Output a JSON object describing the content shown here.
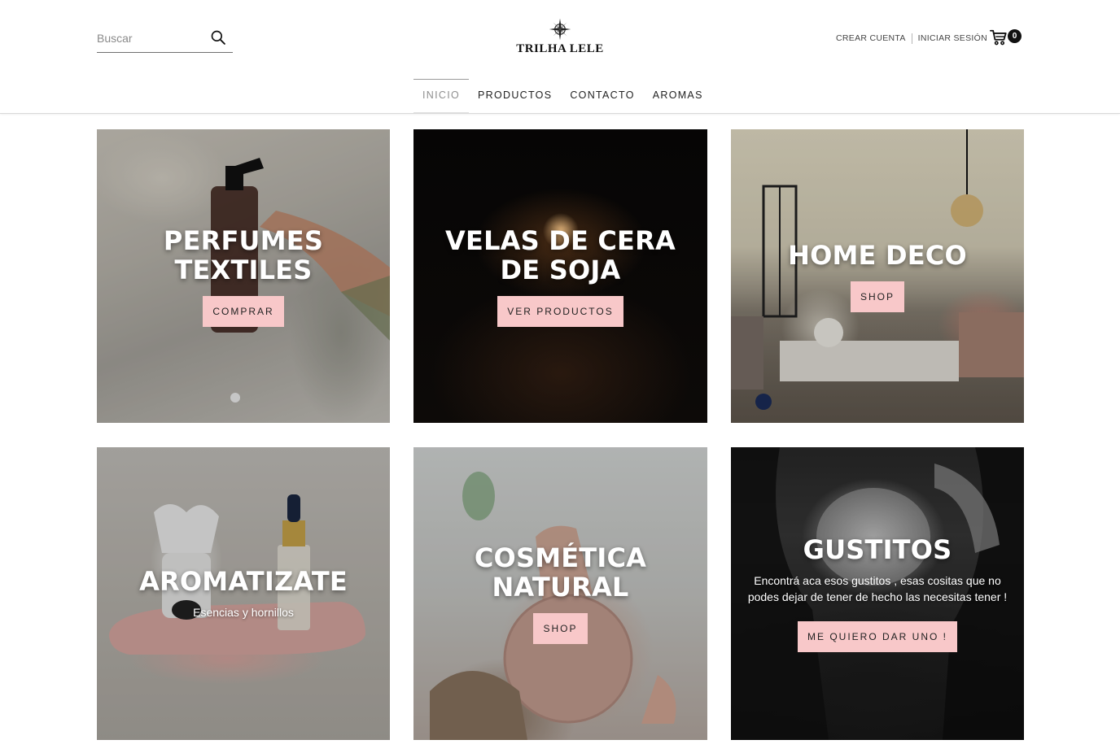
{
  "header": {
    "search_placeholder": "Buscar",
    "brand": "TRILHA LELE",
    "create_account": "CREAR CUENTA",
    "login": "INICIAR SESIÓN",
    "cart_count": "0"
  },
  "nav": {
    "items": [
      {
        "label": "INICIO",
        "active": true
      },
      {
        "label": "PRODUCTOS",
        "active": false
      },
      {
        "label": "CONTACTO",
        "active": false
      },
      {
        "label": "AROMAS",
        "active": false
      }
    ]
  },
  "tiles": [
    {
      "title": "PERFUMES\nTEXTILES",
      "button": "COMPRAR"
    },
    {
      "title": "VELAS DE CERA\nDE SOJA",
      "button": "VER PRODUCTOS"
    },
    {
      "title": "HOME DECO",
      "button": "SHOP"
    },
    {
      "title": "AROMATIZATE",
      "subtitle": "Esencias y hornillos"
    },
    {
      "title": "COSMÉTICA\nNATURAL",
      "button": "SHOP"
    },
    {
      "title": "GUSTITOS",
      "subtitle": "Encontrá aca esos gustitos , esas cositas que no podes dejar de tener de hecho las necesitas tener !",
      "button": "ME QUIERO DAR UNO !"
    }
  ],
  "colors": {
    "button_bg": "#f8c8c9",
    "text_dark": "#222222",
    "badge_bg": "#111111"
  }
}
